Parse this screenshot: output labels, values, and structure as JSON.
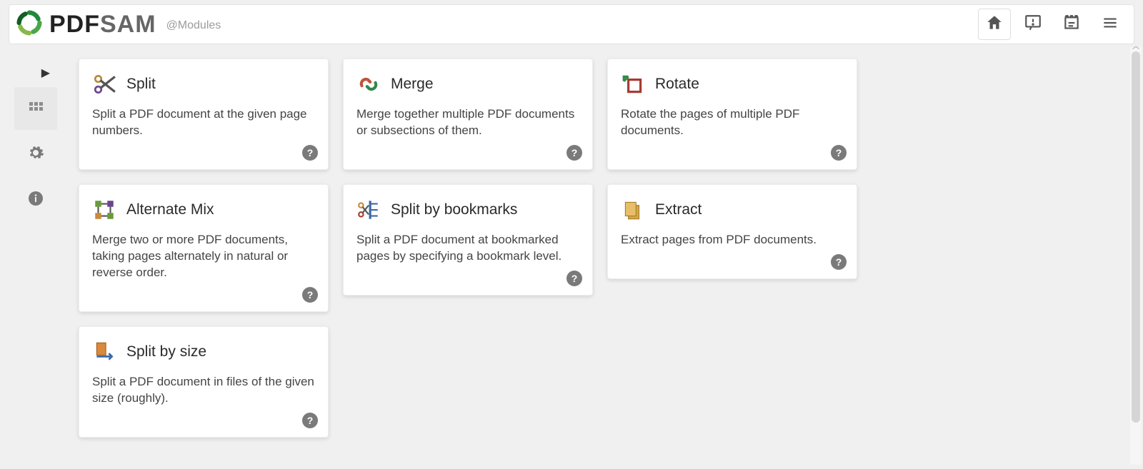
{
  "brand": {
    "pdf": "PDF",
    "sam": "SAM",
    "sub": "@Modules"
  },
  "header_icons": [
    "home-icon",
    "news-icon",
    "log-icon",
    "menu-icon"
  ],
  "sidebar": [
    {
      "name": "collapse-caret-icon"
    },
    {
      "name": "dashboard-button"
    },
    {
      "name": "settings-button"
    },
    {
      "name": "about-button"
    }
  ],
  "modules": [
    {
      "id": "split",
      "title": "Split",
      "desc": "Split a PDF document at the given page numbers."
    },
    {
      "id": "merge",
      "title": "Merge",
      "desc": "Merge together multiple PDF documents or subsections of them."
    },
    {
      "id": "rotate",
      "title": "Rotate",
      "desc": "Rotate the pages of multiple PDF documents."
    },
    {
      "id": "altmix",
      "title": "Alternate Mix",
      "desc": "Merge two or more PDF documents, taking pages alternately in natural or reverse order."
    },
    {
      "id": "splitbm",
      "title": "Split by bookmarks",
      "desc": "Split a PDF document at bookmarked pages by specifying a bookmark level."
    },
    {
      "id": "extract",
      "title": "Extract",
      "desc": "Extract pages from PDF documents."
    },
    {
      "id": "splitsize",
      "title": "Split by size",
      "desc": "Split a PDF document in files of the given size (roughly)."
    }
  ],
  "help_char": "?"
}
